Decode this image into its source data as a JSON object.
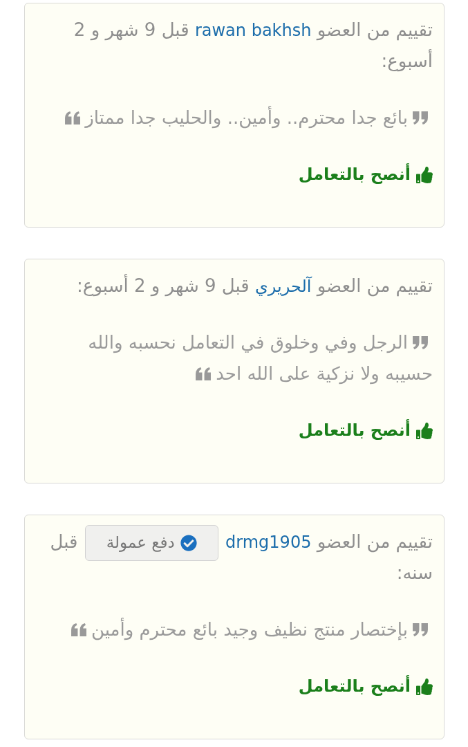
{
  "reviews": [
    {
      "intro": "تقييم من العضو",
      "member": "rawan bakhsh",
      "time": "قبل 9 شهر و 2 أسبوع:",
      "quote": "بائع جدا محترم.. وأمين.. والحليب جدا ممتاز",
      "recommendation": "أنصح بالتعامل"
    },
    {
      "intro": "تقييم من العضو",
      "member": "آلحريري",
      "time": "قبل 9 شهر و 2 أسبوع:",
      "quote": "الرجل وفي وخلوق في التعامل نحسبه والله حسيبه ولا نزكية على الله احد",
      "recommendation": "أنصح بالتعامل"
    },
    {
      "intro": "تقييم من العضو",
      "member": "drmg1905",
      "badge": "دفع عمولة",
      "time": "قبل سنه:",
      "quote": "بإختصار منتج نظيف وجيد بائع محترم وأمين",
      "recommendation": "أنصح بالتعامل"
    }
  ]
}
